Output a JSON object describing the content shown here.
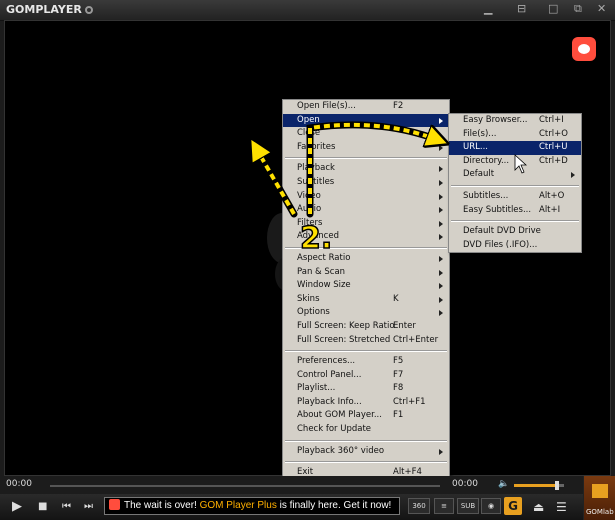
{
  "app": {
    "logo": "GOMPLAYER",
    "logo_tail": ""
  },
  "window": {
    "minimize": "▁",
    "pin": "⊟",
    "maximize": "□",
    "close": "✕"
  },
  "main_menu": [
    {
      "label": "Open File(s)...",
      "shortcut": "F2"
    },
    {
      "label": "Open",
      "shortcut": "",
      "arrow": true,
      "highlight": true
    },
    {
      "label": "Close",
      "shortcut": ""
    },
    {
      "label": "Favorites",
      "shortcut": "",
      "arrow": true
    },
    {
      "sep": true
    },
    {
      "label": "Playback",
      "shortcut": "",
      "arrow": true
    },
    {
      "label": "Subtitles",
      "shortcut": "",
      "arrow": true
    },
    {
      "label": "Video",
      "shortcut": "",
      "arrow": true
    },
    {
      "label": "Audio",
      "shortcut": "",
      "arrow": true
    },
    {
      "label": "Filters",
      "shortcut": "",
      "arrow": true
    },
    {
      "label": "Advanced",
      "shortcut": "",
      "arrow": true
    },
    {
      "sep": true
    },
    {
      "label": "Aspect Ratio",
      "shortcut": "",
      "arrow": true
    },
    {
      "label": "Pan & Scan",
      "shortcut": "",
      "arrow": true
    },
    {
      "label": "Window Size",
      "shortcut": "",
      "arrow": true
    },
    {
      "label": "Skins",
      "shortcut": "K",
      "arrow": true
    },
    {
      "label": "Options",
      "shortcut": "",
      "arrow": true
    },
    {
      "label": "Full Screen: Keep Ratio",
      "shortcut": "Enter"
    },
    {
      "label": "Full Screen: Stretched",
      "shortcut": "Ctrl+Enter"
    },
    {
      "sep": true
    },
    {
      "label": "Preferences...",
      "shortcut": "F5"
    },
    {
      "label": "Control Panel...",
      "shortcut": "F7"
    },
    {
      "label": "Playlist...",
      "shortcut": "F8"
    },
    {
      "label": "Playback Info...",
      "shortcut": "Ctrl+F1"
    },
    {
      "label": "About GOM Player...",
      "shortcut": "F1"
    },
    {
      "label": "Check for Update",
      "shortcut": ""
    },
    {
      "sep": true
    },
    {
      "label": "Playback 360° video",
      "shortcut": "",
      "arrow": true
    },
    {
      "sep": true
    },
    {
      "label": "Exit",
      "shortcut": "Alt+F4"
    }
  ],
  "open_submenu": [
    {
      "label": "Easy Browser...",
      "shortcut": "Ctrl+I"
    },
    {
      "label": "File(s)...",
      "shortcut": "Ctrl+O"
    },
    {
      "label": "URL...",
      "shortcut": "Ctrl+U",
      "highlight": true
    },
    {
      "label": "Directory...",
      "shortcut": "Ctrl+D"
    },
    {
      "label": "Default",
      "shortcut": "",
      "arrow": true
    },
    {
      "sep": true
    },
    {
      "label": "Subtitles...",
      "shortcut": "Alt+O"
    },
    {
      "label": "Easy Subtitles...",
      "shortcut": "Alt+I"
    },
    {
      "sep": true
    },
    {
      "label": "Default DVD Drive",
      "shortcut": ""
    },
    {
      "label": "DVD Files (.IFO)...",
      "shortcut": ""
    }
  ],
  "annotation": {
    "step_label": "2."
  },
  "progress": {
    "elapsed": "00:00",
    "total": "00:00",
    "volume_fraction": 0.85
  },
  "controls": {
    "play": "▶",
    "stop": "■",
    "prev": "⏮",
    "next": "⏭",
    "ticker_parts": [
      "The wait is over! ",
      "GOM Player Plus",
      " is finally here. Get it now!"
    ],
    "btn_sub": "SUB",
    "btn_gom": "G",
    "eject": "⏏",
    "menu": "☰",
    "gomlab_label": "GOMlab"
  },
  "colors": {
    "accent": "#e8a020",
    "menu_highlight": "#0a246a",
    "annotation_yellow": "#ffe000"
  }
}
